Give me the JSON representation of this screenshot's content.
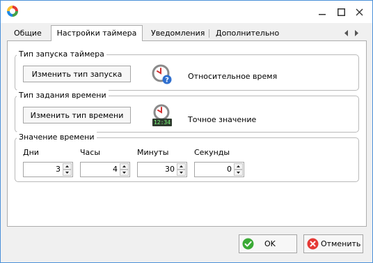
{
  "tabs": [
    {
      "label": "Общие",
      "active": false
    },
    {
      "label": "Настройки таймера",
      "active": true
    },
    {
      "label": "Уведомления",
      "active": false
    },
    {
      "label": "Дополнительно",
      "active": false
    }
  ],
  "launch_type": {
    "title": "Тип запуска таймера",
    "button": "Изменить тип запуска",
    "value": "Относительное время",
    "icon": "clock-question-icon"
  },
  "time_type": {
    "title": "Тип задания времени",
    "button": "Изменить тип времени",
    "value": "Точное значение",
    "display": "12:34",
    "icon": "clock-digital-icon"
  },
  "time_value": {
    "title": "Значение времени",
    "fields": [
      {
        "label": "Дни",
        "value": "3"
      },
      {
        "label": "Часы",
        "value": "4"
      },
      {
        "label": "Минуты",
        "value": "30"
      },
      {
        "label": "Секунды",
        "value": "0"
      }
    ]
  },
  "footer": {
    "ok": "OK",
    "cancel": "Отменить"
  },
  "colors": {
    "accent": "#4a90d9",
    "ok_green": "#3aaa35",
    "cancel_red": "#e53935",
    "clock_red": "#d32f2f"
  }
}
